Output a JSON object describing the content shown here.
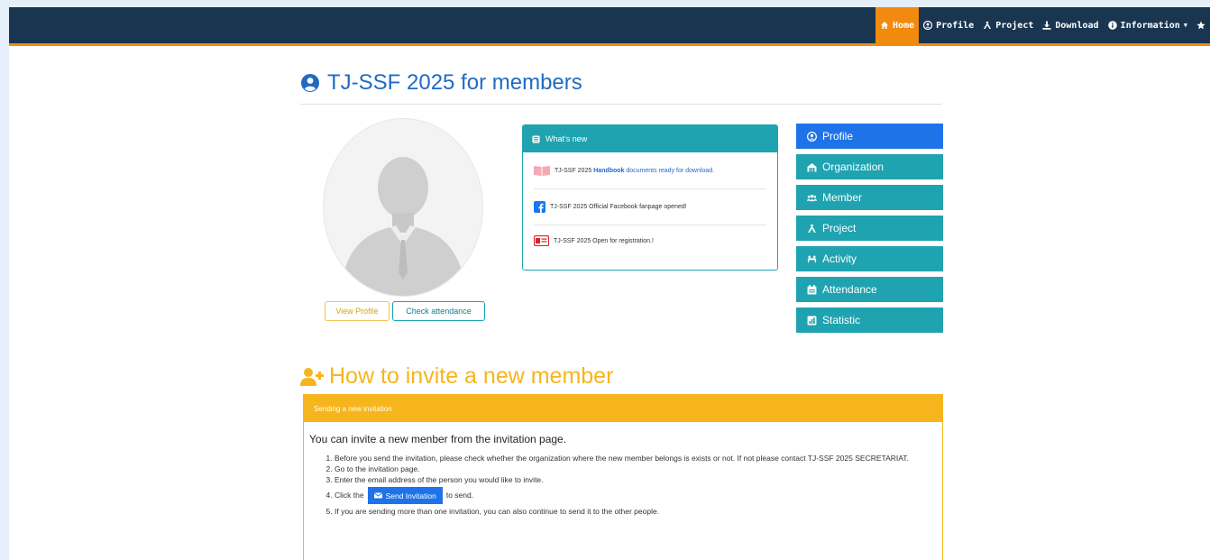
{
  "navbar": {
    "items": [
      {
        "label": "Home",
        "icon": "home-icon",
        "active": true
      },
      {
        "label": "Profile",
        "icon": "user-circle-icon"
      },
      {
        "label": "Project",
        "icon": "project-icon"
      },
      {
        "label": "Download",
        "icon": "download-icon"
      },
      {
        "label": "Information",
        "icon": "info-circle-icon",
        "dropdown": true
      },
      {
        "label": "",
        "icon": "star-icon"
      }
    ],
    "colors": {
      "bar": "#1a3550",
      "active": "#f28a0f"
    }
  },
  "page": {
    "title": "TJ-SSF 2025 for members"
  },
  "profile_card": {
    "view_profile": "View Profile",
    "check_attendance": "Check attendance"
  },
  "whats_new": {
    "heading": "What's new",
    "items": [
      {
        "icon": "book-icon",
        "pre": "TJ-SSF 2025 ",
        "highlight": "Handbook",
        "post": " documents ready for download."
      },
      {
        "icon": "facebook-icon",
        "text": "TJ-SSF 2025 Official Facebook fanpage opened!"
      },
      {
        "icon": "id-card-icon",
        "text": "TJ-SSF 2025 Open for registration.!"
      }
    ]
  },
  "menu": {
    "items": [
      {
        "label": "Profile",
        "icon": "user-circle-icon"
      },
      {
        "label": "Organization",
        "icon": "organization-icon"
      },
      {
        "label": "Member",
        "icon": "users-icon"
      },
      {
        "label": "Project",
        "icon": "project-icon"
      },
      {
        "label": "Activity",
        "icon": "activity-icon"
      },
      {
        "label": "Attendance",
        "icon": "calendar-icon"
      },
      {
        "label": "Statistic",
        "icon": "chart-icon"
      }
    ],
    "colors": {
      "primary": "#1e73e8",
      "teal": "#1fa3b0"
    }
  },
  "invite": {
    "title": "How to invite a new member",
    "card_heading": "Sending a new invitation",
    "intro": "You can invite a new menber from the invitation page.",
    "steps": [
      "Before you send the invitation, please check whether the organization where the new member belongs is exists or not. If not please contact TJ-SSF 2025 SECRETARIAT.",
      "Go to the invitation page.",
      "Enter the email address of the person you would like to invite."
    ],
    "step4_pre": "Click the",
    "send_button": "Send Invitation",
    "step4_post": "to send.",
    "step5": "If you are sending more than one invitation, you can also continue to send it to the other people."
  }
}
